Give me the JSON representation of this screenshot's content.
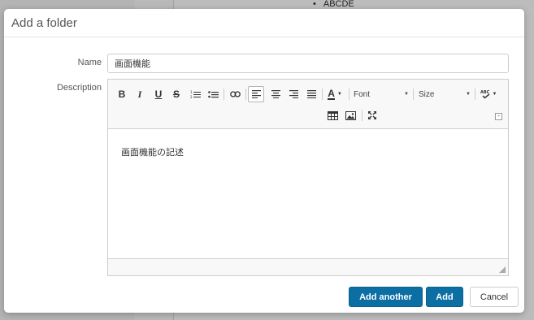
{
  "background": {
    "bullet_item": "ABCDE"
  },
  "dialog": {
    "title": "Add a folder",
    "name_label": "Name",
    "name_value": "画面機能",
    "description_label": "Description"
  },
  "editor": {
    "toolbar": {
      "bold": "B",
      "italic": "I",
      "underline": "U",
      "strike": "S",
      "font_label": "Font",
      "size_label": "Size",
      "text_color": "A"
    },
    "content": "画面機能の記述"
  },
  "footer": {
    "add_another": "Add another",
    "add": "Add",
    "cancel": "Cancel"
  }
}
